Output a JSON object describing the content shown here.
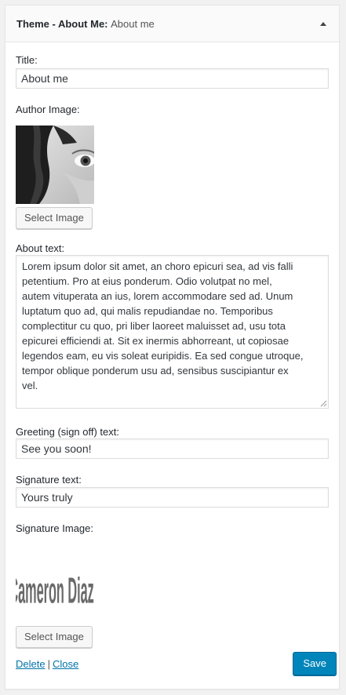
{
  "widget": {
    "title_bold": "Theme - About Me:",
    "title_sub": "About me"
  },
  "fields": {
    "title_label": "Title:",
    "title_value": "About me",
    "author_image_label": "Author Image:",
    "select_image_label": "Select Image",
    "about_label": "About text:",
    "about_lines": [
      "Lorem ipsum dolor sit amet, an choro epicuri sea, ad vis falli",
      "petentium. Pro at eius ponderum. Odio volutpat no mel,",
      "autem vituperata an ius, lorem accommodare sed ad. Unum",
      "luptatum quo ad, qui malis repudiandae no. Temporibus",
      "complectitur cu quo, pri liber laoreet maluisset ad, usu tota",
      "epicurei efficiendi at. Sit ex inermis abhorreant, ut copiosae",
      "legendos eam, eu vis soleat euripidis. Ea sed congue utroque,",
      "tempor oblique ponderum usu ad, sensibus suscipiantur ex",
      "vel."
    ],
    "greeting_label": "Greeting (sign off) text:",
    "greeting_value": "See you soon!",
    "signature_text_label": "Signature text:",
    "signature_text_value": "Yours truly",
    "signature_image_label": "Signature Image:",
    "signature_image_text": "Cameron Diaz"
  },
  "actions": {
    "delete": "Delete",
    "separator": "|",
    "close": "Close",
    "save": "Save"
  },
  "colors": {
    "link": "#0073aa",
    "primary_button": "#0085ba"
  }
}
